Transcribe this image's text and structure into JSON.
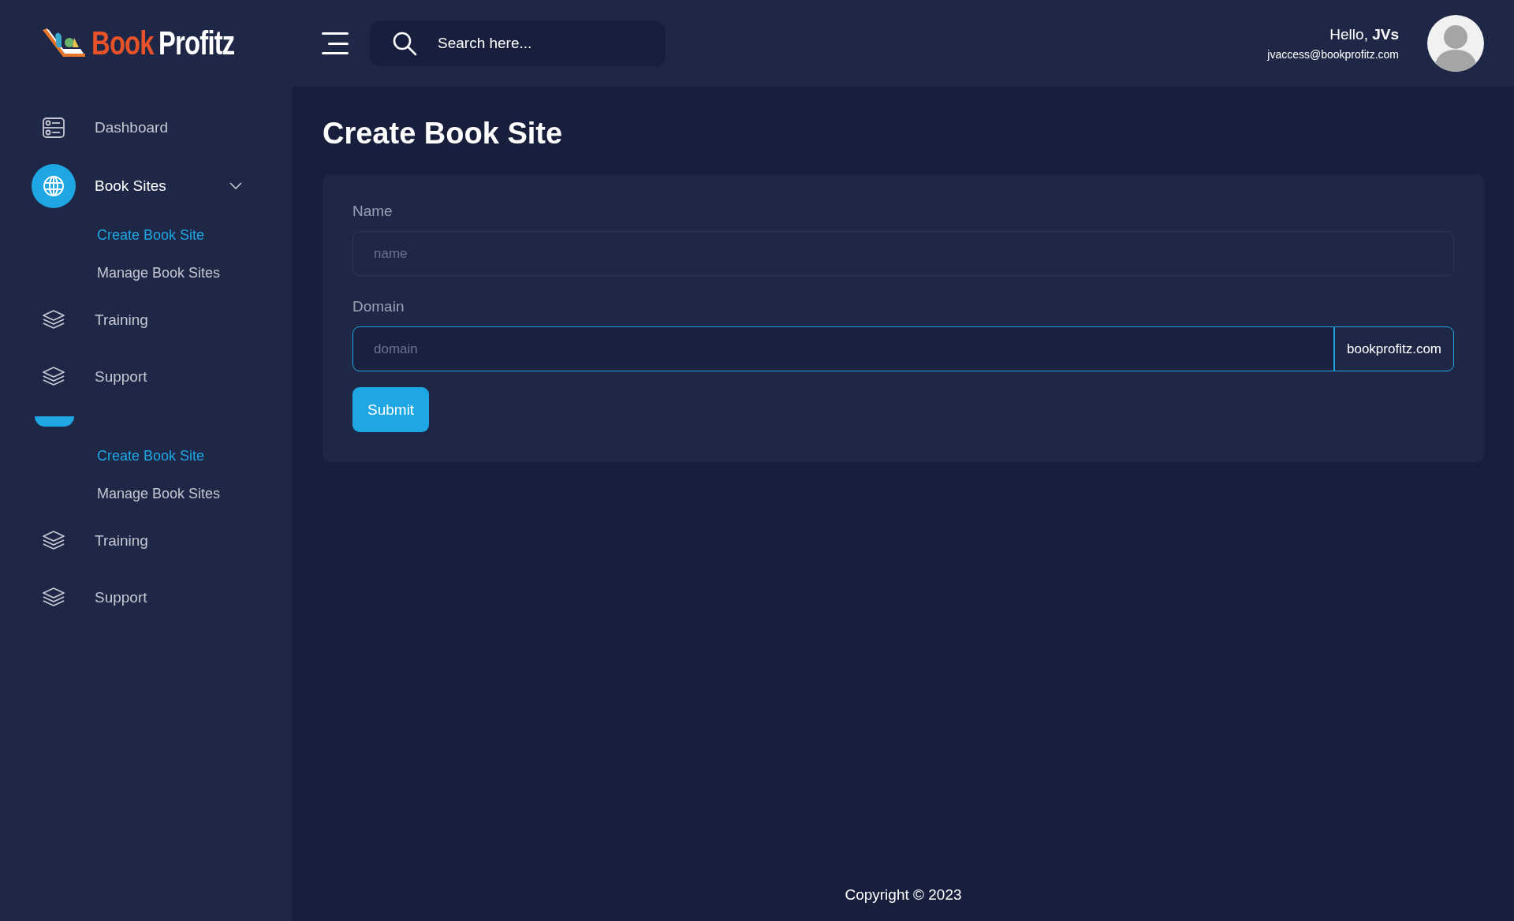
{
  "header": {
    "logo": {
      "part_1": "Book",
      "part_2": "Profitz"
    },
    "search": {
      "placeholder": "Search here..."
    },
    "user": {
      "greeting": "Hello, **JVs**",
      "email": "jvaccess@bookprofitz.com"
    }
  },
  "sidebar": {
    "items": [
      {
        "kind": "dashboard",
        "label": "Dashboard",
        "selected": false
      },
      {
        "kind": "group",
        "label": "Book Sites",
        "selected": true,
        "expanded": true,
        "children": [
          {
            "label": "Create Book Site",
            "selected": true
          },
          {
            "label": "Manage Book Sites",
            "selected": false
          }
        ]
      },
      {
        "kind": "section",
        "label": "Training",
        "selected": false
      },
      {
        "kind": "section",
        "label": "Support",
        "selected": false
      },
      {
        "kind": "stub",
        "selected": true,
        "expanded": true,
        "children": [
          {
            "label": "Create Book Site",
            "selected": true
          },
          {
            "label": "Manage Book Sites",
            "selected": false
          }
        ]
      },
      {
        "kind": "section",
        "label": "Training",
        "selected": false
      },
      {
        "kind": "section",
        "label": "Support",
        "selected": false
      }
    ]
  },
  "page": {
    "title": "Create Book Site",
    "form": {
      "fields": [
        {
          "label": "Name",
          "placeholder": "name",
          "focused": false
        },
        {
          "label": "Domain",
          "placeholder": "domain",
          "suffix": "bookprofitz.com",
          "focused": true
        }
      ],
      "submit": "Submit"
    }
  },
  "footer": {
    "copyright": "Copyright © 2023"
  }
}
